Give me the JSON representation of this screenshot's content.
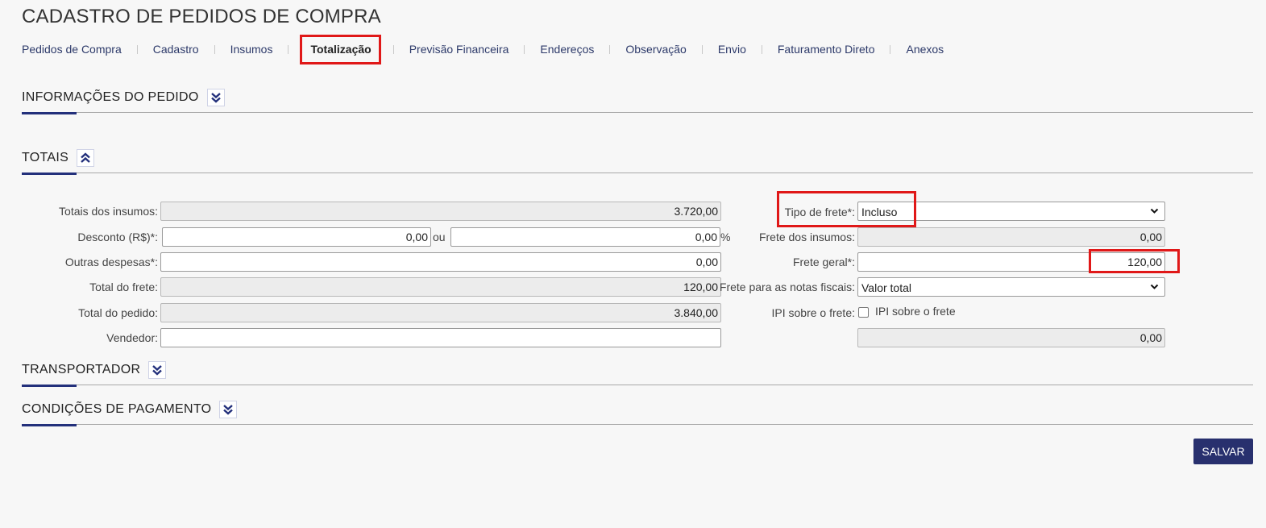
{
  "page_title": "CADASTRO DE PEDIDOS DE COMPRA",
  "tabs": [
    {
      "label": "Pedidos de Compra"
    },
    {
      "label": "Cadastro"
    },
    {
      "label": "Insumos"
    },
    {
      "label": "Totalização",
      "active": true
    },
    {
      "label": "Previsão Financeira"
    },
    {
      "label": "Endereços"
    },
    {
      "label": "Observação"
    },
    {
      "label": "Envio"
    },
    {
      "label": "Faturamento Direto"
    },
    {
      "label": "Anexos"
    }
  ],
  "sections": {
    "info": {
      "title": "INFORMAÇÕES DO PEDIDO",
      "toggle_icon": "chevron-double-down-icon"
    },
    "totais": {
      "title": "TOTAIS",
      "toggle_icon": "chevron-double-up-icon"
    },
    "transportador": {
      "title": "TRANSPORTADOR",
      "toggle_icon": "chevron-double-down-icon"
    },
    "pagamento": {
      "title": "CONDIÇÕES DE PAGAMENTO",
      "toggle_icon": "chevron-double-down-icon"
    }
  },
  "totais": {
    "totais_insumos": {
      "label": "Totais dos insumos:",
      "value": "3.720,00"
    },
    "desconto": {
      "label": "Desconto (R$)*:",
      "value": "0,00",
      "ou": "ou",
      "percent_value": "0,00",
      "percent_symbol": "%"
    },
    "outras_despesas": {
      "label": "Outras despesas*:",
      "value": "0,00"
    },
    "total_frete": {
      "label": "Total do frete:",
      "value": "120,00"
    },
    "total_pedido": {
      "label": "Total do pedido:",
      "value": "3.840,00"
    },
    "vendedor": {
      "label": "Vendedor:",
      "value": ""
    },
    "tipo_frete": {
      "label": "Tipo de frete*:",
      "value": "Incluso"
    },
    "frete_insumos": {
      "label": "Frete dos insumos:",
      "value": "0,00"
    },
    "frete_geral": {
      "label": "Frete geral*:",
      "value": "120,00"
    },
    "frete_notas": {
      "label": "Frete para as notas fiscais:",
      "value": "Valor total"
    },
    "ipi_frete": {
      "label": "IPI sobre o frete:",
      "checkbox_label": "IPI sobre o frete",
      "checked": false,
      "value": "0,00"
    }
  },
  "buttons": {
    "save": "SALVAR"
  },
  "colors": {
    "accent": "#23307b",
    "highlight": "#e01818",
    "button": "#28306e"
  }
}
